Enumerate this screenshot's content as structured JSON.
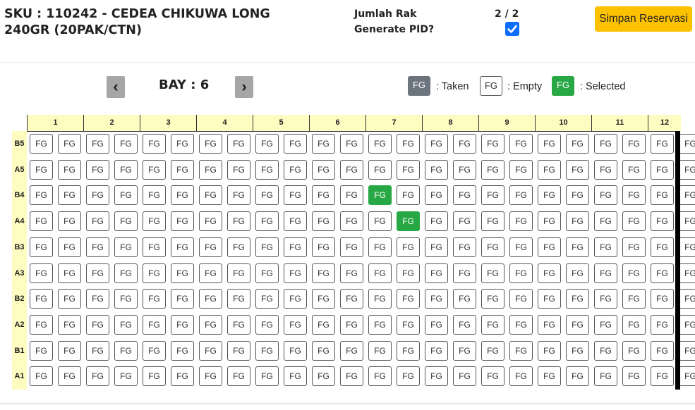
{
  "header": {
    "title": "SKU : 110242 - CEDEA CHIKUWA LONG 240GR (20PAK/CTN)",
    "jumlah_rak_label": "Jumlah Rak",
    "jumlah_rak_value": "2 / 2",
    "generate_pid_label": "Generate PID?",
    "generate_pid_checked": true,
    "save_label": "Simpan Reservasi"
  },
  "bay": {
    "label": "BAY : 6",
    "prev": "‹",
    "next": "›"
  },
  "legend": [
    {
      "box": "FG",
      "text": ": Taken",
      "state": "taken"
    },
    {
      "box": "FG",
      "text": ": Empty",
      "state": "empty"
    },
    {
      "box": "FG",
      "text": ": Selected",
      "state": "selected"
    }
  ],
  "grid": {
    "columns": [
      "1",
      "2",
      "3",
      "4",
      "5",
      "6",
      "7",
      "8",
      "9",
      "10",
      "11",
      "12"
    ],
    "rows": [
      "B5",
      "A5",
      "B4",
      "A4",
      "B3",
      "A3",
      "B2",
      "A2",
      "B1",
      "A1"
    ],
    "cell_label": "FG",
    "selected": [
      {
        "row": "B4",
        "slot": 12
      },
      {
        "row": "A4",
        "slot": 13
      }
    ]
  },
  "colors": {
    "selected": "#27a844",
    "taken": "#6c757d",
    "header_bg": "#fffcc1",
    "save_button": "#fcc100",
    "checkbox": "#0d6efd"
  }
}
